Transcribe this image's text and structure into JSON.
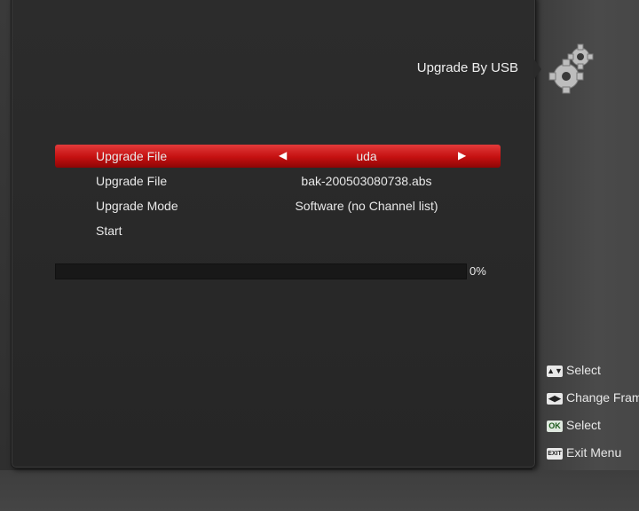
{
  "header": {
    "title": "Upgrade By USB",
    "icon": "gear-icon"
  },
  "menu": {
    "rows": [
      {
        "label": "Upgrade File",
        "value": "uda",
        "selected": true
      },
      {
        "label": "Upgrade File",
        "value": "bak-200503080738.abs",
        "selected": false
      },
      {
        "label": "Upgrade Mode",
        "value": "Software (no Channel list)",
        "selected": false
      },
      {
        "label": "Start",
        "value": "",
        "selected": false
      }
    ]
  },
  "progress": {
    "value": 0,
    "label": "0%"
  },
  "help": [
    {
      "key": "▲▼",
      "icon": "up-down-key-icon",
      "text": "Select"
    },
    {
      "key": "◀▶",
      "icon": "left-right-key-icon",
      "text": "Change Frame"
    },
    {
      "key": "OK",
      "icon": "ok-key-icon",
      "text": "Select"
    },
    {
      "key": "EXIT",
      "icon": "exit-key-icon",
      "text": "Exit Menu"
    }
  ],
  "colors": {
    "accent": "#c41010",
    "panel": "#282828"
  }
}
